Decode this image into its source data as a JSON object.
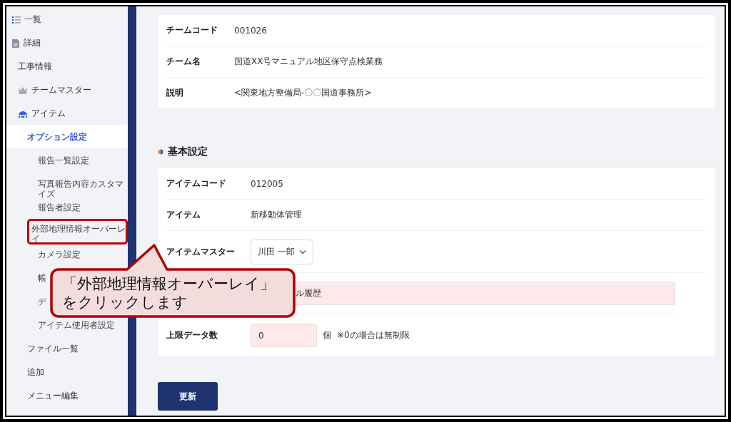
{
  "sidebar": {
    "items": [
      {
        "label": "一覧",
        "selected": false
      },
      {
        "label": "詳細",
        "selected": false,
        "children": [
          {
            "label": "工事情報",
            "selected": false
          },
          {
            "label": "チームマスター",
            "selected": false
          },
          {
            "label": "アイテム",
            "selected": false,
            "children": [
              {
                "label": "オプション設定",
                "selected": true,
                "children": [
                  {
                    "label": "報告一覧設定",
                    "selected": false,
                    "highlighted": false
                  },
                  {
                    "label": "写真報告内容カスタマイズ",
                    "selected": false,
                    "highlighted": false
                  },
                  {
                    "label": "報告者設定",
                    "selected": false,
                    "highlighted": false
                  },
                  {
                    "label": "外部地理情報オーバーレイ",
                    "selected": false,
                    "highlighted": true
                  },
                  {
                    "label": "カメラ設定",
                    "selected": false,
                    "highlighted": false
                  },
                  {
                    "label": "帳",
                    "selected": false,
                    "highlighted": false
                  },
                  {
                    "label": "デ",
                    "selected": false,
                    "highlighted": false
                  },
                  {
                    "label": "アイテム使用者設定",
                    "selected": false,
                    "highlighted": false
                  }
                ]
              },
              {
                "label": "ファイル一覧",
                "selected": false
              },
              {
                "label": "追加",
                "selected": false
              },
              {
                "label": "メニュー編集",
                "selected": false
              }
            ]
          }
        ]
      }
    ]
  },
  "team_card": {
    "rows": [
      {
        "label": "チームコード",
        "kind": "text",
        "value": "001026"
      },
      {
        "label": "チーム名",
        "kind": "text",
        "value": "国道XX号マニュアル地区保守点検業務"
      },
      {
        "label": "説明",
        "kind": "text",
        "value": "<関東地方整備局-〇〇国道事務所>"
      }
    ]
  },
  "basic_settings": {
    "title": "基本設定",
    "rows": [
      {
        "label": "アイテムコード",
        "kind": "text",
        "value": "012005"
      },
      {
        "label": "アイテム",
        "kind": "text",
        "value": "新移動体管理"
      },
      {
        "label": "アイテムマスター",
        "kind": "select",
        "value": "川田 一郎"
      },
      {
        "kind": "wide_input",
        "value": "ル履歴"
      },
      {
        "label": "上限データ数",
        "kind": "number_input",
        "value": "0",
        "unit": "個",
        "note": "※0の場合は無制限"
      }
    ]
  },
  "update_button": "更新",
  "callout": {
    "lines": [
      "「外部地理情報オーバーレイ」",
      "をクリックします"
    ]
  }
}
